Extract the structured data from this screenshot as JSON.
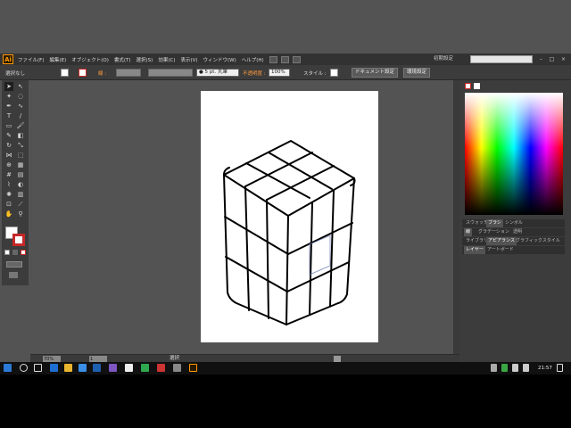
{
  "app": {
    "logo": "Ai"
  },
  "menu": [
    "ファイル(F)",
    "編集(E)",
    "オブジェクト(O)",
    "書式(T)",
    "選択(S)",
    "効果(C)",
    "表示(V)",
    "ウィンドウ(W)",
    "ヘルプ(H)"
  ],
  "workspace": "初期設定",
  "control": {
    "selection_label": "選択なし",
    "stroke_label": "線 :",
    "stroke_size": "● 5 pt. 丸筆",
    "opacity_label": "不透明度 :",
    "opacity_value": "100%",
    "style_label": "スタイル :",
    "doc_settings": "ドキュメント設定",
    "prefs": "環境設定"
  },
  "colors": {
    "accent": "#ff9a00",
    "stroke_red": "#c62828",
    "artboard": "#ffffff",
    "workspace_bg": "#535353"
  },
  "panels": {
    "row1": [
      "スウォッチ",
      "ブラシ",
      "シンボル"
    ],
    "row1_active": 1,
    "row2": [
      "線",
      "グラデーション",
      "透明"
    ],
    "row3": [
      "ライブラリ",
      "アピアランス",
      "グラフィックスタイル"
    ],
    "row3_active": 1,
    "row4": [
      "レイヤー",
      "アートボード"
    ],
    "row4_active": 0
  },
  "status": {
    "zoom": "70%",
    "page": "1",
    "tool": "選択"
  },
  "taskbar": {
    "time": "21:57"
  }
}
